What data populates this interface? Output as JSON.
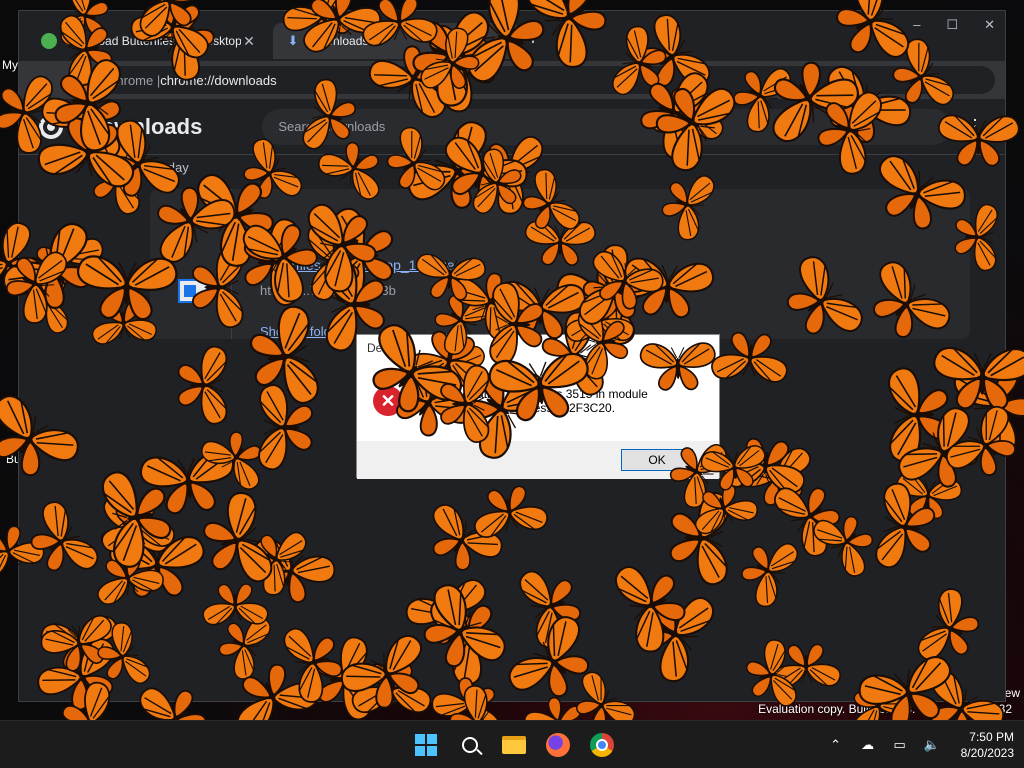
{
  "desktop": {
    "left_labels": [
      "My",
      "Bu"
    ],
    "evaluation_text": "Evaluation copy. Build 25375.",
    "evaluation_suffix": "32",
    "side_fragment": "ew"
  },
  "browser": {
    "tabs": [
      {
        "title": "Download Butterflies On Desktop",
        "active": false
      },
      {
        "title": "Downloads",
        "active": true
      }
    ],
    "new_tab": "+",
    "window_controls": [
      "⌄",
      "–",
      "☐",
      "✕"
    ],
    "omnibox": {
      "prefix": "Chrome  |  ",
      "url": "chrome://downloads"
    },
    "back_icon": "arrow-left-icon",
    "forward_icon": "arrow-right-icon"
  },
  "downloads_page": {
    "heading": "Downloads",
    "search_placeholder": "Search downloads",
    "date_group": "Today",
    "items": [
      {
        "filename": "butterflies_on_desktop_1.0.exe",
        "url": "https://...7d2041ce9e3b",
        "show_in_folder": "Show in folder"
      }
    ]
  },
  "dialog": {
    "title": "Desktop",
    "message_line1": "Access violation at address 3515 in module",
    "message_line2": "'... .exe'. Read of address 722F3C20.",
    "ok_label": "OK",
    "close_glyph": "✕"
  },
  "taskbar": {
    "apps": [
      "start-button",
      "search-button",
      "file-explorer",
      "firefox",
      "chrome"
    ],
    "tray": {
      "chevron": "⌃",
      "cloud": "☁",
      "network": "▭",
      "volume": "🔈"
    },
    "time": "7:50 PM",
    "date": "8/20/2023"
  },
  "colors": {
    "butterfly_orange": "#f07a10",
    "butterfly_vein": "#1a0d05",
    "accent": "#8ab4f8"
  }
}
